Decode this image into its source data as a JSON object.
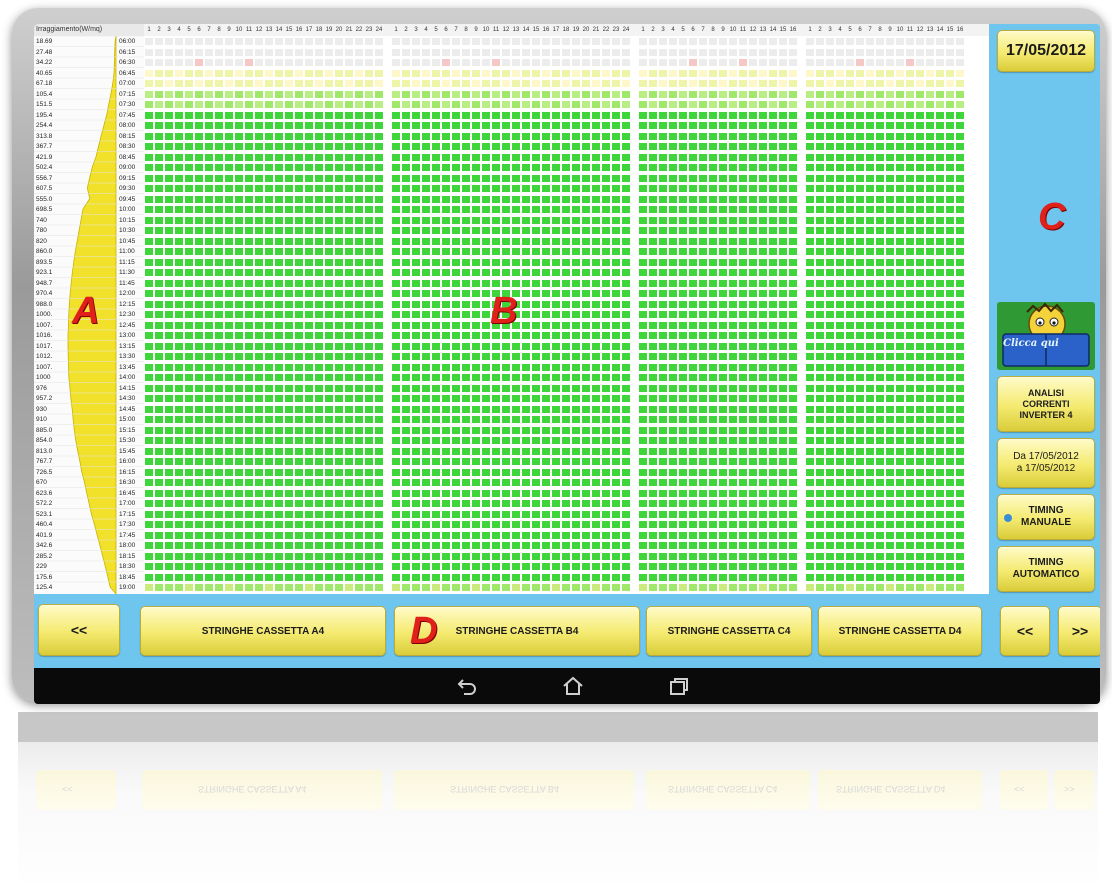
{
  "header": {
    "irradiance_title": "Irraggiamento(W/mq)",
    "panel_columns": [
      24,
      24,
      16,
      16
    ]
  },
  "irradiance": {
    "values": [
      "18.69",
      "27.48",
      "34.22",
      "40.65",
      "67.18",
      "105.4",
      "151.5",
      "195.4",
      "254.4",
      "313.8",
      "367.7",
      "421.9",
      "502.4",
      "556.7",
      "607.5",
      "555.0",
      "698.5",
      "740",
      "780",
      "820",
      "860.0",
      "893.5",
      "923.1",
      "948.7",
      "970.4",
      "988.0",
      "1000.",
      "1007.",
      "1016.",
      "1017.",
      "1012.",
      "1007.",
      "1000",
      "976",
      "957.2",
      "930",
      "910",
      "885.0",
      "854.0",
      "813.0",
      "767.7",
      "726.5",
      "670",
      "623.6",
      "572.2",
      "523.1",
      "460.4",
      "401.9",
      "342.6",
      "285.2",
      "229",
      "175.6",
      "125.4"
    ],
    "times": [
      "06:00",
      "06:15",
      "06:30",
      "06:45",
      "07:00",
      "07:15",
      "07:30",
      "07:45",
      "08:00",
      "08:15",
      "08:30",
      "08:45",
      "09:00",
      "09:15",
      "09:30",
      "09:45",
      "10:00",
      "10:15",
      "10:30",
      "10:45",
      "11:00",
      "11:15",
      "11:30",
      "11:45",
      "12:00",
      "12:15",
      "12:30",
      "12:45",
      "13:00",
      "13:15",
      "13:30",
      "13:45",
      "14:00",
      "14:15",
      "14:30",
      "14:45",
      "15:00",
      "15:15",
      "15:30",
      "15:45",
      "16:00",
      "16:15",
      "16:30",
      "16:45",
      "17:00",
      "17:15",
      "17:30",
      "17:45",
      "18:00",
      "18:15",
      "18:30",
      "18:45",
      "19:00"
    ]
  },
  "annotations": {
    "a": "A",
    "b": "B",
    "c": "C",
    "d": "D"
  },
  "sidebar": {
    "date": "17/05/2012",
    "click_icon_text": "Clicca qui",
    "analysis_line1": "ANALISI",
    "analysis_line2": "CORRENTI",
    "analysis_line3": "INVERTER 4",
    "range_line1": "Da 17/05/2012",
    "range_line2": "a 17/05/2012",
    "manual_line1": "TIMING",
    "manual_line2": "MANUALE",
    "auto_line1": "TIMING",
    "auto_line2": "AUTOMATICO"
  },
  "bottom": {
    "prev_left": "<<",
    "tab_a4": "STRINGHE CASSETTA A4",
    "tab_b4": "STRINGHE CASSETTA B4",
    "tab_c4": "STRINGHE CASSETTA C4",
    "tab_d4": "STRINGHE CASSETTA D4",
    "prev_right": "<<",
    "next_right": ">>"
  },
  "colors": {
    "cell_green": "#3ed63a",
    "cell_light": "#9fe86a",
    "cell_yellow": "#eef5a8",
    "cell_blank": "#ececec",
    "curve_yellow": "#f2e12a",
    "screen_blue": "#6ec6ee"
  },
  "icons": [
    "back-icon",
    "home-icon",
    "recent-apps-icon"
  ]
}
